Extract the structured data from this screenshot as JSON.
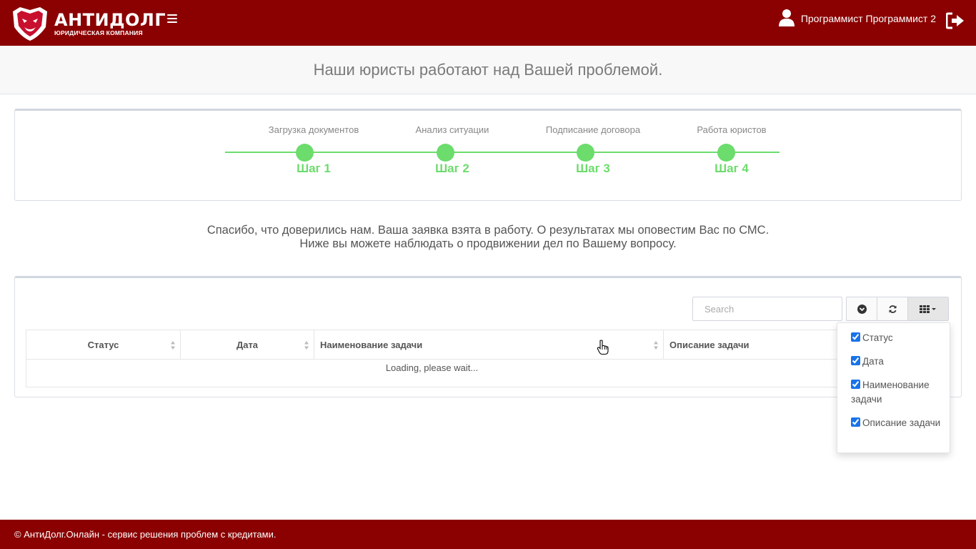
{
  "header": {
    "logo_title": "АНТИДОЛГ",
    "logo_subtitle": "ЮРИДИЧЕСКАЯ КОМПАНИЯ",
    "user_name": "Программист Программист 2",
    "colors": {
      "brand": "#8b0000",
      "accent_green": "#6cdc6c"
    }
  },
  "subheader": {
    "title": "Наши юристы работают над Вашей проблемой."
  },
  "steps": [
    {
      "caption": "Загрузка документов",
      "label": "Шаг 1"
    },
    {
      "caption": "Анализ ситуации",
      "label": "Шаг 2"
    },
    {
      "caption": "Подписание договора",
      "label": "Шаг 3"
    },
    {
      "caption": "Работа юристов",
      "label": "Шаг 4"
    }
  ],
  "message": {
    "line1": "Спасибо, что доверились нам. Ваша заявка взята в работу. О результатах мы оповестим Вас по СМС.",
    "line2": "Ниже вы можете наблюдать о продвижении дел по Вашему вопросу."
  },
  "table": {
    "search_placeholder": "Search",
    "columns": [
      "Статус",
      "Дата",
      "Наименование задачи",
      "Описание задачи"
    ],
    "loading_text": "Loading, please wait..."
  },
  "column_menu": {
    "items": [
      {
        "label": "Статус",
        "checked": true
      },
      {
        "label": "Дата",
        "checked": true
      },
      {
        "label": "Наименование задачи",
        "checked": true
      },
      {
        "label": "Описание задачи",
        "checked": true
      }
    ]
  },
  "footer": {
    "text": "© АнтиДолг.Онлайн - сервис решения проблем с кредитами."
  }
}
